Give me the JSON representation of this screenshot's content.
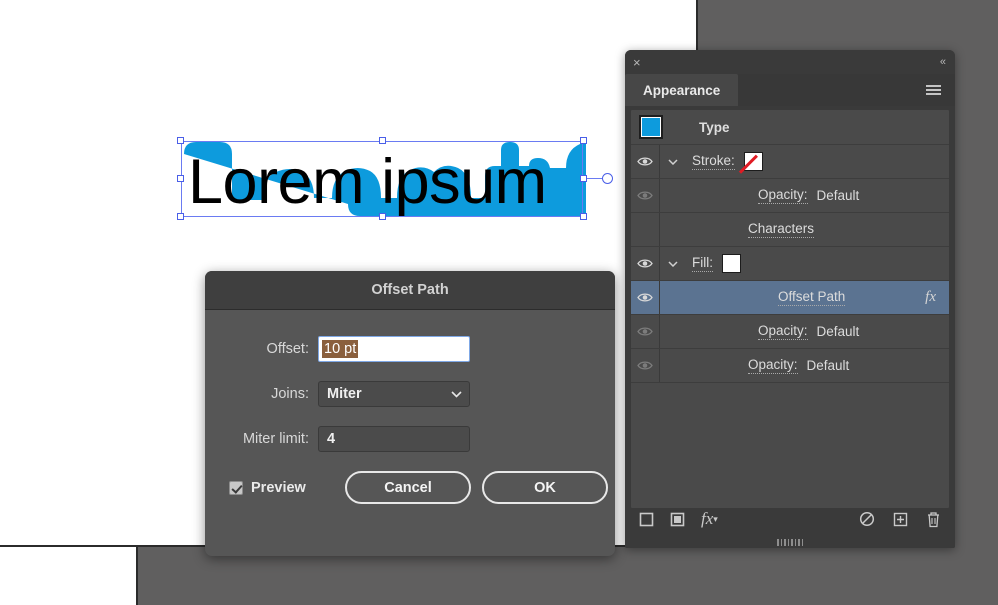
{
  "app": {
    "canvas_bg": "#605f5f",
    "artboard_bg": "#ffffff",
    "accent_blue": "#0d9bdd",
    "selection_blue": "#6a7bf2"
  },
  "artwork": {
    "text": "Lorem ipsum",
    "text_color": "#000000",
    "offset_fill": "#0d9bdd"
  },
  "dialog": {
    "title": "Offset Path",
    "offset": {
      "label": "Offset:",
      "value": "10 pt",
      "selected": true
    },
    "joins": {
      "label": "Joins:",
      "value": "Miter",
      "chevron": "chevron-down-icon"
    },
    "miter_limit": {
      "label": "Miter limit:",
      "value": "4"
    },
    "preview": {
      "label": "Preview",
      "checked": true
    },
    "cancel_label": "Cancel",
    "ok_label": "OK"
  },
  "panel": {
    "close_icon": "×",
    "collapse_icon": "«",
    "tab_label": "Appearance",
    "menu_icon": "hamburger-menu-icon",
    "type_row": {
      "label": "Type",
      "swatch_color": "#0d9bdd"
    },
    "rows": [
      {
        "label": "Stroke:",
        "value": "",
        "eye": true,
        "eye_dim": false,
        "arrow": true,
        "swatch": "none",
        "swatch_color": "#ffffff",
        "indent": 0,
        "selected": false,
        "fx": false
      },
      {
        "label": "Opacity:",
        "value": "Default",
        "eye": true,
        "eye_dim": true,
        "arrow": false,
        "swatch": null,
        "indent": 1,
        "selected": false,
        "fx": false
      },
      {
        "label": "Characters",
        "value": "",
        "eye": false,
        "eye_dim": false,
        "arrow": false,
        "swatch": null,
        "indent": 3,
        "selected": false,
        "fx": false
      },
      {
        "label": "Fill:",
        "value": "",
        "eye": true,
        "eye_dim": false,
        "arrow": true,
        "swatch": "color",
        "swatch_color": "#0d9bdd",
        "indent": 0,
        "selected": false,
        "fx": false
      },
      {
        "label": "Offset Path",
        "value": "",
        "eye": true,
        "eye_dim": false,
        "arrow": false,
        "swatch": null,
        "indent": 2,
        "selected": true,
        "fx": true,
        "fx_label": "fx"
      },
      {
        "label": "Opacity:",
        "value": "Default",
        "eye": true,
        "eye_dim": true,
        "arrow": false,
        "swatch": null,
        "indent": 1,
        "selected": false,
        "fx": false
      },
      {
        "label": "Opacity:",
        "value": "Default",
        "eye": true,
        "eye_dim": true,
        "arrow": false,
        "swatch": null,
        "indent": 3,
        "selected": false,
        "fx": false
      }
    ],
    "bottom_bar": [
      {
        "name": "add-new-stroke-button",
        "icon": "square-outline-icon"
      },
      {
        "name": "add-new-fill-button",
        "icon": "square-filled-icon"
      },
      {
        "name": "add-new-effect-button",
        "icon": "fx-icon",
        "label": "fx"
      },
      {
        "name": "clear-appearance-button",
        "icon": "circle-slash-icon"
      },
      {
        "name": "duplicate-item-button",
        "icon": "plus-box-icon"
      },
      {
        "name": "delete-item-button",
        "icon": "trash-icon"
      }
    ]
  }
}
